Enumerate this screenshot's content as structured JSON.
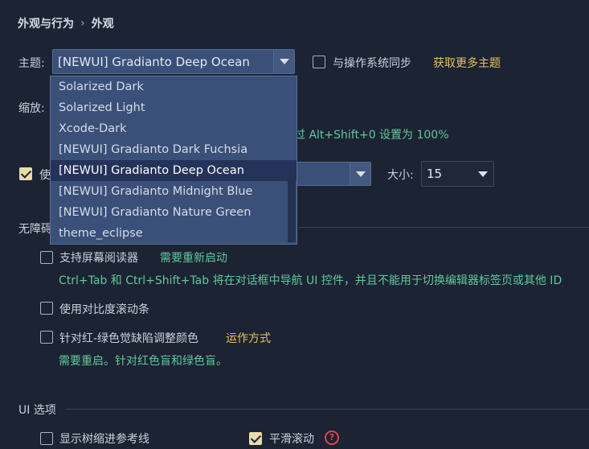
{
  "breadcrumb": {
    "parent": "外观与行为",
    "separator": "›",
    "current": "外观"
  },
  "theme": {
    "label": "主题:",
    "selected": "[NEWUI] Gradianto Deep Ocean",
    "sync_label": "与操作系统同步",
    "more_link": "获取更多主题",
    "options": [
      "Solarized Dark",
      "Solarized Light",
      "Xcode-Dark",
      "[NEWUI] Gradianto Dark Fuchsia",
      "[NEWUI] Gradianto Deep Ocean",
      "[NEWUI] Gradianto Midnight Blue",
      "[NEWUI] Gradianto Nature Green",
      "theme_eclipse"
    ]
  },
  "zoom": {
    "label": "缩放:",
    "hint": "过 Alt+Shift+0 设置为 100%"
  },
  "font": {
    "checkbox_label": "使",
    "size_label": "大小:",
    "size_value": "15"
  },
  "accessibility": {
    "header": "无障碍",
    "screen_reader": {
      "label": "支持屏幕阅读器",
      "link": "需要重新启动",
      "hint": "Ctrl+Tab 和 Ctrl+Shift+Tab 将在对话框中导航 UI 控件，并且不能用于切换编辑器标签页或其他 ID"
    },
    "contrast_scrollbars": {
      "label": "使用对比度滚动条"
    },
    "color_deficiency": {
      "label": "针对红-绿色觉缺陷调整颜色",
      "link": "运作方式",
      "hint": "需要重启。针对红色盲和绿色盲。"
    }
  },
  "ui_options": {
    "header": "UI 选项",
    "tree_indent": {
      "label": "显示树缩进参考线"
    },
    "smooth_scroll": {
      "label": "平滑滚动",
      "help": "?"
    }
  },
  "colors": {
    "background": "#1c2333",
    "accent_green": "#5fc99a",
    "accent_gold": "#e6c35a",
    "combo": "#3a5079",
    "selection": "#25325a"
  }
}
